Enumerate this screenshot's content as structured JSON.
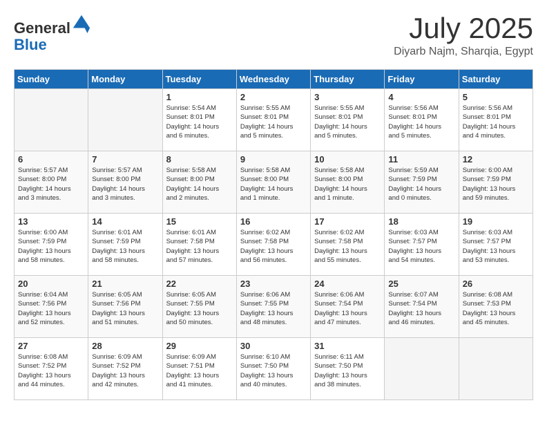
{
  "header": {
    "logo_line1": "General",
    "logo_line2": "Blue",
    "month_title": "July 2025",
    "location": "Diyarb Najm, Sharqia, Egypt"
  },
  "calendar": {
    "weekdays": [
      "Sunday",
      "Monday",
      "Tuesday",
      "Wednesday",
      "Thursday",
      "Friday",
      "Saturday"
    ],
    "weeks": [
      [
        {
          "day": "",
          "info": ""
        },
        {
          "day": "",
          "info": ""
        },
        {
          "day": "1",
          "info": "Sunrise: 5:54 AM\nSunset: 8:01 PM\nDaylight: 14 hours\nand 6 minutes."
        },
        {
          "day": "2",
          "info": "Sunrise: 5:55 AM\nSunset: 8:01 PM\nDaylight: 14 hours\nand 5 minutes."
        },
        {
          "day": "3",
          "info": "Sunrise: 5:55 AM\nSunset: 8:01 PM\nDaylight: 14 hours\nand 5 minutes."
        },
        {
          "day": "4",
          "info": "Sunrise: 5:56 AM\nSunset: 8:01 PM\nDaylight: 14 hours\nand 5 minutes."
        },
        {
          "day": "5",
          "info": "Sunrise: 5:56 AM\nSunset: 8:01 PM\nDaylight: 14 hours\nand 4 minutes."
        }
      ],
      [
        {
          "day": "6",
          "info": "Sunrise: 5:57 AM\nSunset: 8:00 PM\nDaylight: 14 hours\nand 3 minutes."
        },
        {
          "day": "7",
          "info": "Sunrise: 5:57 AM\nSunset: 8:00 PM\nDaylight: 14 hours\nand 3 minutes."
        },
        {
          "day": "8",
          "info": "Sunrise: 5:58 AM\nSunset: 8:00 PM\nDaylight: 14 hours\nand 2 minutes."
        },
        {
          "day": "9",
          "info": "Sunrise: 5:58 AM\nSunset: 8:00 PM\nDaylight: 14 hours\nand 1 minute."
        },
        {
          "day": "10",
          "info": "Sunrise: 5:58 AM\nSunset: 8:00 PM\nDaylight: 14 hours\nand 1 minute."
        },
        {
          "day": "11",
          "info": "Sunrise: 5:59 AM\nSunset: 7:59 PM\nDaylight: 14 hours\nand 0 minutes."
        },
        {
          "day": "12",
          "info": "Sunrise: 6:00 AM\nSunset: 7:59 PM\nDaylight: 13 hours\nand 59 minutes."
        }
      ],
      [
        {
          "day": "13",
          "info": "Sunrise: 6:00 AM\nSunset: 7:59 PM\nDaylight: 13 hours\nand 58 minutes."
        },
        {
          "day": "14",
          "info": "Sunrise: 6:01 AM\nSunset: 7:59 PM\nDaylight: 13 hours\nand 58 minutes."
        },
        {
          "day": "15",
          "info": "Sunrise: 6:01 AM\nSunset: 7:58 PM\nDaylight: 13 hours\nand 57 minutes."
        },
        {
          "day": "16",
          "info": "Sunrise: 6:02 AM\nSunset: 7:58 PM\nDaylight: 13 hours\nand 56 minutes."
        },
        {
          "day": "17",
          "info": "Sunrise: 6:02 AM\nSunset: 7:58 PM\nDaylight: 13 hours\nand 55 minutes."
        },
        {
          "day": "18",
          "info": "Sunrise: 6:03 AM\nSunset: 7:57 PM\nDaylight: 13 hours\nand 54 minutes."
        },
        {
          "day": "19",
          "info": "Sunrise: 6:03 AM\nSunset: 7:57 PM\nDaylight: 13 hours\nand 53 minutes."
        }
      ],
      [
        {
          "day": "20",
          "info": "Sunrise: 6:04 AM\nSunset: 7:56 PM\nDaylight: 13 hours\nand 52 minutes."
        },
        {
          "day": "21",
          "info": "Sunrise: 6:05 AM\nSunset: 7:56 PM\nDaylight: 13 hours\nand 51 minutes."
        },
        {
          "day": "22",
          "info": "Sunrise: 6:05 AM\nSunset: 7:55 PM\nDaylight: 13 hours\nand 50 minutes."
        },
        {
          "day": "23",
          "info": "Sunrise: 6:06 AM\nSunset: 7:55 PM\nDaylight: 13 hours\nand 48 minutes."
        },
        {
          "day": "24",
          "info": "Sunrise: 6:06 AM\nSunset: 7:54 PM\nDaylight: 13 hours\nand 47 minutes."
        },
        {
          "day": "25",
          "info": "Sunrise: 6:07 AM\nSunset: 7:54 PM\nDaylight: 13 hours\nand 46 minutes."
        },
        {
          "day": "26",
          "info": "Sunrise: 6:08 AM\nSunset: 7:53 PM\nDaylight: 13 hours\nand 45 minutes."
        }
      ],
      [
        {
          "day": "27",
          "info": "Sunrise: 6:08 AM\nSunset: 7:52 PM\nDaylight: 13 hours\nand 44 minutes."
        },
        {
          "day": "28",
          "info": "Sunrise: 6:09 AM\nSunset: 7:52 PM\nDaylight: 13 hours\nand 42 minutes."
        },
        {
          "day": "29",
          "info": "Sunrise: 6:09 AM\nSunset: 7:51 PM\nDaylight: 13 hours\nand 41 minutes."
        },
        {
          "day": "30",
          "info": "Sunrise: 6:10 AM\nSunset: 7:50 PM\nDaylight: 13 hours\nand 40 minutes."
        },
        {
          "day": "31",
          "info": "Sunrise: 6:11 AM\nSunset: 7:50 PM\nDaylight: 13 hours\nand 38 minutes."
        },
        {
          "day": "",
          "info": ""
        },
        {
          "day": "",
          "info": ""
        }
      ]
    ]
  }
}
